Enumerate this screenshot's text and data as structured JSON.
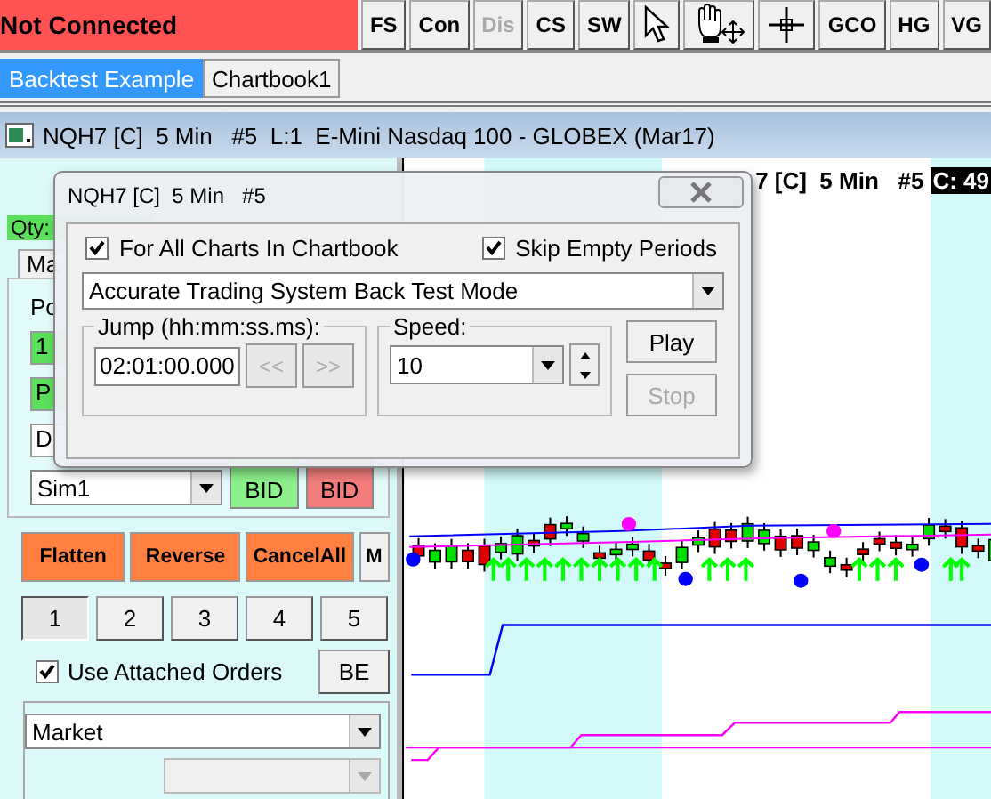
{
  "toolbar": {
    "status": "Not Connected",
    "items": [
      {
        "kind": "text",
        "label": "FS",
        "disabled": false
      },
      {
        "kind": "text",
        "label": "Con",
        "disabled": false
      },
      {
        "kind": "text",
        "label": "Dis",
        "disabled": true
      },
      {
        "kind": "text",
        "label": "CS",
        "disabled": false
      },
      {
        "kind": "text",
        "label": "SW",
        "disabled": false
      },
      {
        "kind": "pointer"
      },
      {
        "kind": "hand"
      },
      {
        "kind": "crosshair"
      },
      {
        "kind": "text",
        "label": "GCO",
        "disabled": false
      },
      {
        "kind": "text",
        "label": "HG",
        "disabled": false
      },
      {
        "kind": "text",
        "label": "VG",
        "disabled": false
      }
    ]
  },
  "tabs": [
    {
      "label": "Backtest Example",
      "selected": true
    },
    {
      "label": "Chartbook1",
      "selected": false
    }
  ],
  "chart_window": {
    "title": "NQH7 [C]  5 Min   #5  L:1  E-Mini Nasdaq 100 - GLOBEX (Mar17)",
    "header": "7 [C]  5 Min   #5",
    "price": "C: 49"
  },
  "trade_panel": {
    "qty_label": "Qty:",
    "tab": "Ma",
    "position_label": "Po",
    "position_value": "1",
    "pl_label": "P",
    "d_field": "D",
    "account": "Sim1",
    "buy": "BID",
    "sell": "BID",
    "actions": [
      {
        "label": "Flatten"
      },
      {
        "label": "Reverse"
      },
      {
        "label": "CancelAll"
      }
    ],
    "m_button": "M",
    "quantities": [
      {
        "label": "1",
        "selected": true
      },
      {
        "label": "2",
        "selected": false
      },
      {
        "label": "3",
        "selected": false
      },
      {
        "label": "4",
        "selected": false
      },
      {
        "label": "5",
        "selected": false
      }
    ],
    "attached_orders": {
      "label": "Use Attached Orders",
      "checked": true
    },
    "be_button": "BE",
    "order_type": "Market"
  },
  "dialog": {
    "title": "NQH7 [C]  5 Min   #5",
    "options": [
      {
        "label": "For All Charts In Chartbook",
        "checked": true
      },
      {
        "label": "Skip Empty Periods",
        "checked": true
      }
    ],
    "mode": "Accurate Trading System Back Test Mode",
    "jump": {
      "label": "Jump (hh:mm:ss.ms):",
      "value": "02:01:00.000",
      "back": "<<",
      "forward": ">>",
      "nav_disabled": true
    },
    "speed": {
      "label": "Speed:",
      "value": "10"
    },
    "play": {
      "label": "Play",
      "disabled": false
    },
    "stop": {
      "label": "Stop",
      "disabled": true
    }
  }
}
